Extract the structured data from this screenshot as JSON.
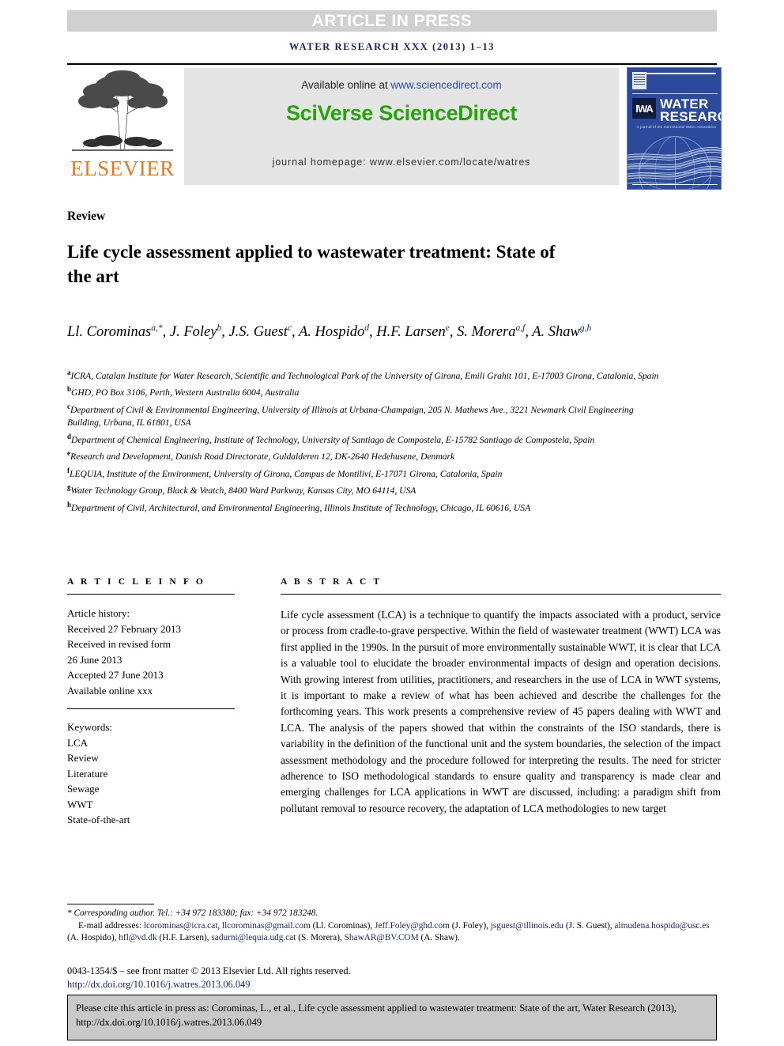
{
  "banner": {
    "press_label": "ARTICLE IN PRESS",
    "journal_line": "WATER RESEARCH XXX (2013) 1–13"
  },
  "masthead": {
    "publisher_name": "ELSEVIER",
    "available_prefix": "Available online at ",
    "available_url": "www.sciencedirect.com",
    "platform_title": "SciVerse ScienceDirect",
    "homepage_line": "journal homepage: www.elsevier.com/locate/watres",
    "cover": {
      "title_line1": "WATER",
      "title_line2": "RESEARCH",
      "logo_text": "IWA",
      "subtitle": "A journal of the International Water Association"
    }
  },
  "article": {
    "type_label": "Review",
    "title": "Life cycle assessment applied to wastewater treatment: State of the art",
    "authors": [
      {
        "name": "Ll. Corominas",
        "marks": "a,*",
        "sep": ", "
      },
      {
        "name": "J. Foley",
        "marks": "b",
        "sep": ", "
      },
      {
        "name": "J.S. Guest",
        "marks": "c",
        "sep": ", "
      },
      {
        "name": "A. Hospido",
        "marks": "d",
        "sep": ", "
      },
      {
        "name": "H.F. Larsen",
        "marks": "e",
        "sep": ", "
      },
      {
        "name": "S. Morera",
        "marks": "a,f",
        "sep": ", "
      },
      {
        "name": "A. Shaw",
        "marks": "g,h",
        "sep": ""
      }
    ],
    "affiliations": [
      {
        "mark": "a",
        "text": "ICRA, Catalan Institute for Water Research, Scientific and Technological Park of the University of Girona, Emili Grahit 101, E-17003 Girona, Catalonia, Spain"
      },
      {
        "mark": "b",
        "text": "GHD, PO Box 3106, Perth, Western Australia 6004, Australia"
      },
      {
        "mark": "c",
        "text": "Department of Civil & Environmental Engineering, University of Illinois at Urbana-Champaign, 205 N. Mathews Ave., 3221 Newmark Civil Engineering Building, Urbana, IL 61801, USA"
      },
      {
        "mark": "d",
        "text": "Department of Chemical Engineering, Institute of Technology, University of Santiago de Compostela, E-15782 Santiago de Compostela, Spain"
      },
      {
        "mark": "e",
        "text": "Research and Development, Danish Road Directorate, Guldalderen 12, DK-2640 Hedehusene, Denmark"
      },
      {
        "mark": "f",
        "text": "LEQUIA, Institute of the Environment, University of Girona, Campus de Montilivi, E-17071 Girona, Catalonia, Spain"
      },
      {
        "mark": "g",
        "text": "Water Technology Group, Black & Veatch, 8400 Ward Parkway, Kansas City, MO 64114, USA"
      },
      {
        "mark": "h",
        "text": "Department of Civil, Architectural, and Environmental Engineering, Illinois Institute of Technology, Chicago, IL 60616, USA"
      }
    ]
  },
  "info": {
    "heading": "A R T I C L E  I N F O",
    "history_label": "Article history:",
    "history": [
      "Received 27 February 2013",
      "Received in revised form",
      "26 June 2013",
      "Accepted 27 June 2013",
      "Available online xxx"
    ],
    "keywords_label": "Keywords:",
    "keywords": [
      "LCA",
      "Review",
      "Literature",
      "Sewage",
      "WWT",
      "State-of-the-art"
    ]
  },
  "abstract": {
    "heading": "A B S T R A C T",
    "text": "Life cycle assessment (LCA) is a technique to quantify the impacts associated with a product, service or process from cradle-to-grave perspective. Within the field of wastewater treatment (WWT) LCA was first applied in the 1990s. In the pursuit of more environmentally sustainable WWT, it is clear that LCA is a valuable tool to elucidate the broader environmental impacts of design and operation decisions. With growing interest from utilities, practitioners, and researchers in the use of LCA in WWT systems, it is important to make a review of what has been achieved and describe the challenges for the forthcoming years. This work presents a comprehensive review of 45 papers dealing with WWT and LCA. The analysis of the papers showed that within the constraints of the ISO standards, there is variability in the definition of the functional unit and the system boundaries, the selection of the impact assessment methodology and the procedure followed for interpreting the results. The need for stricter adherence to ISO methodological standards to ensure quality and transparency is made clear and emerging challenges for LCA applications in WWT are discussed, including: a paradigm shift from pollutant removal to resource recovery, the adaptation of LCA methodologies to new target"
  },
  "footnotes": {
    "corresponding": "* Corresponding author. Tel.: +34 972 183380; fax: +34 972 183248.",
    "email_label": "E-mail addresses:",
    "emails": [
      {
        "address": "lcorominas@icra.cat",
        "owner": ""
      },
      {
        "address": "llcorominas@gmail.com",
        "owner": "(Ll. Corominas)"
      },
      {
        "address": "Jeff.Foley@ghd.com",
        "owner": "(J. Foley)"
      },
      {
        "address": "jsguest@illinois.edu",
        "owner": "(J. S. Guest)"
      },
      {
        "address": "almudena.hospido@usc.es",
        "owner": "(A. Hospido)"
      },
      {
        "address": "hfl@vd.dk",
        "owner": "(H.F. Larsen)"
      },
      {
        "address": "sadurni@lequia.udg.cat",
        "owner": "(S. Morera)"
      },
      {
        "address": "ShawAR@BV.COM",
        "owner": "(A. Shaw)"
      }
    ],
    "copyright": "0043-1354/$ – see front matter © 2013 Elsevier Ltd. All rights reserved.",
    "doi": "http://dx.doi.org/10.1016/j.watres.2013.06.049"
  },
  "cite_box": {
    "text": "Please cite this article in press as: Corominas, L., et al., Life cycle assessment applied to wastewater treatment: State of the art, Water Research (2013), http://dx.doi.org/10.1016/j.watres.2013.06.049"
  },
  "colors": {
    "banner_gray": "#d0d0d0",
    "navy": "#14245c",
    "elsevier_orange": "#E87722",
    "sciencedirect_green": "#27a30b",
    "cover_blue": "#2b4a9b",
    "cite_gray": "#c9c9c9"
  }
}
